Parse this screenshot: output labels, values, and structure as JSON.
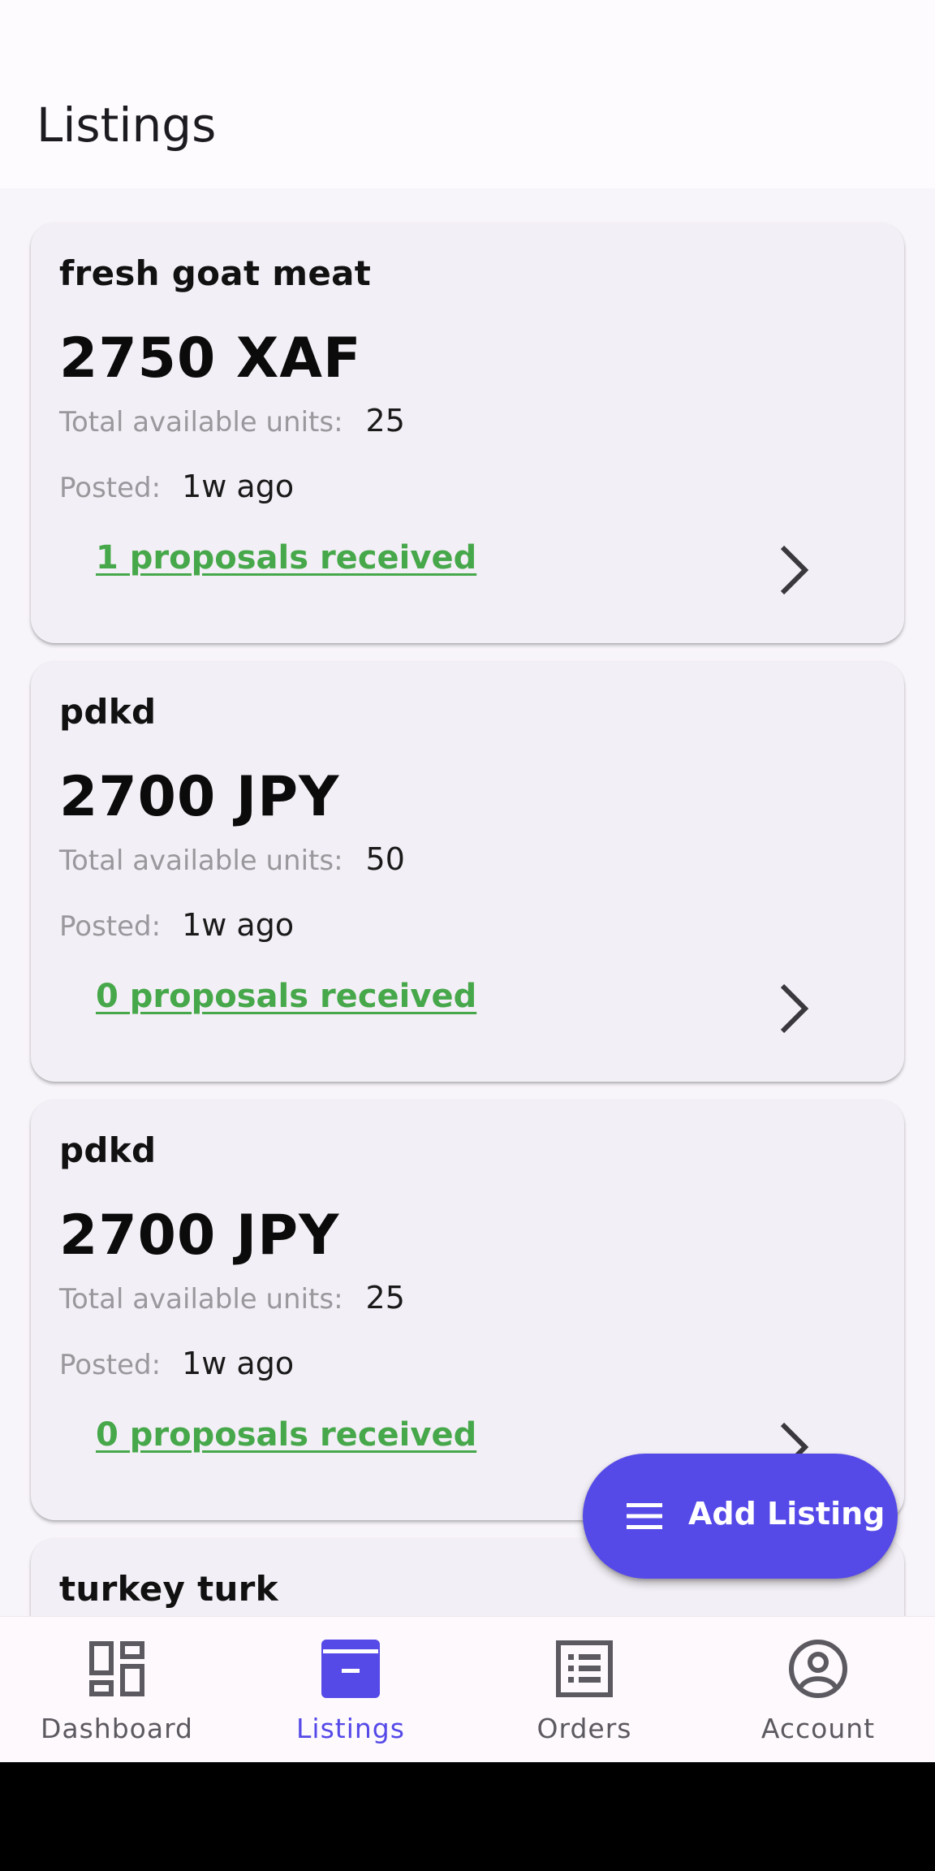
{
  "header": {
    "title": "Listings"
  },
  "listings": [
    {
      "name": "fresh goat meat",
      "price": "2750 XAF",
      "units_label": "Total available units:",
      "units": "25",
      "posted_label": "Posted:",
      "posted": "1w ago",
      "proposals": "1 proposals received"
    },
    {
      "name": "pdkd",
      "price": "2700 JPY",
      "units_label": "Total available units:",
      "units": "50",
      "posted_label": "Posted:",
      "posted": "1w ago",
      "proposals": "0 proposals received"
    },
    {
      "name": "pdkd",
      "price": "2700 JPY",
      "units_label": "Total available units:",
      "units": "25",
      "posted_label": "Posted:",
      "posted": "1w ago",
      "proposals": "0 proposals received"
    },
    {
      "name": "turkey turk"
    }
  ],
  "fab": {
    "label": "Add Listing",
    "icon": "menu-icon"
  },
  "nav": {
    "items": [
      {
        "label": "Dashboard",
        "icon": "dashboard-icon",
        "active": false
      },
      {
        "label": "Listings",
        "icon": "archive-icon",
        "active": true
      },
      {
        "label": "Orders",
        "icon": "list-alt-icon",
        "active": false
      },
      {
        "label": "Account",
        "icon": "account-circle-icon",
        "active": false
      }
    ]
  },
  "colors": {
    "accent": "#5549e8",
    "link_green": "#46a84a",
    "card_bg": "#f3eff6",
    "page_bg": "#f8f5fa"
  }
}
